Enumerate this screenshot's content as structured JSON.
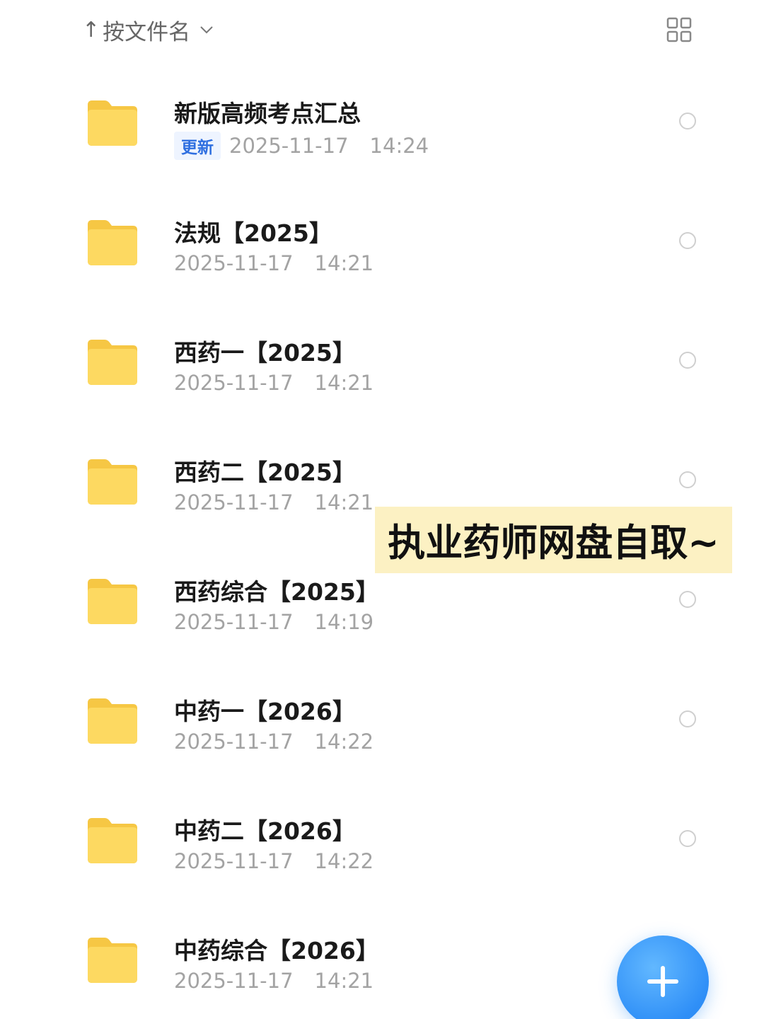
{
  "toolbar": {
    "sort_arrow": "↑",
    "sort_label": "按文件名",
    "sort_chevron_icon": "chevron-down-icon",
    "view_toggle_icon": "grid-view-icon"
  },
  "files": [
    {
      "name": "新版高频考点汇总",
      "badge": "更新",
      "date": "2025-11-17",
      "time": "14:24"
    },
    {
      "name": "法规【2025】",
      "badge": "",
      "date": "2025-11-17",
      "time": "14:21"
    },
    {
      "name": "西药一【2025】",
      "badge": "",
      "date": "2025-11-17",
      "time": "14:21"
    },
    {
      "name": "西药二【2025】",
      "badge": "",
      "date": "2025-11-17",
      "time": "14:21"
    },
    {
      "name": "西药综合【2025】",
      "badge": "",
      "date": "2025-11-17",
      "time": "14:19"
    },
    {
      "name": "中药一【2026】",
      "badge": "",
      "date": "2025-11-17",
      "time": "14:22"
    },
    {
      "name": "中药二【2026】",
      "badge": "",
      "date": "2025-11-17",
      "time": "14:22"
    },
    {
      "name": "中药综合【2026】",
      "badge": "",
      "date": "2025-11-17",
      "time": "14:21"
    }
  ],
  "overlay": {
    "text": "执业药师网盘自取~",
    "background": "#fcf1c3"
  },
  "fab": {
    "icon": "plus-icon",
    "color": "#2f8ff7"
  },
  "colors": {
    "folder": "#fcd55a",
    "badge_text": "#2f6fe0"
  }
}
